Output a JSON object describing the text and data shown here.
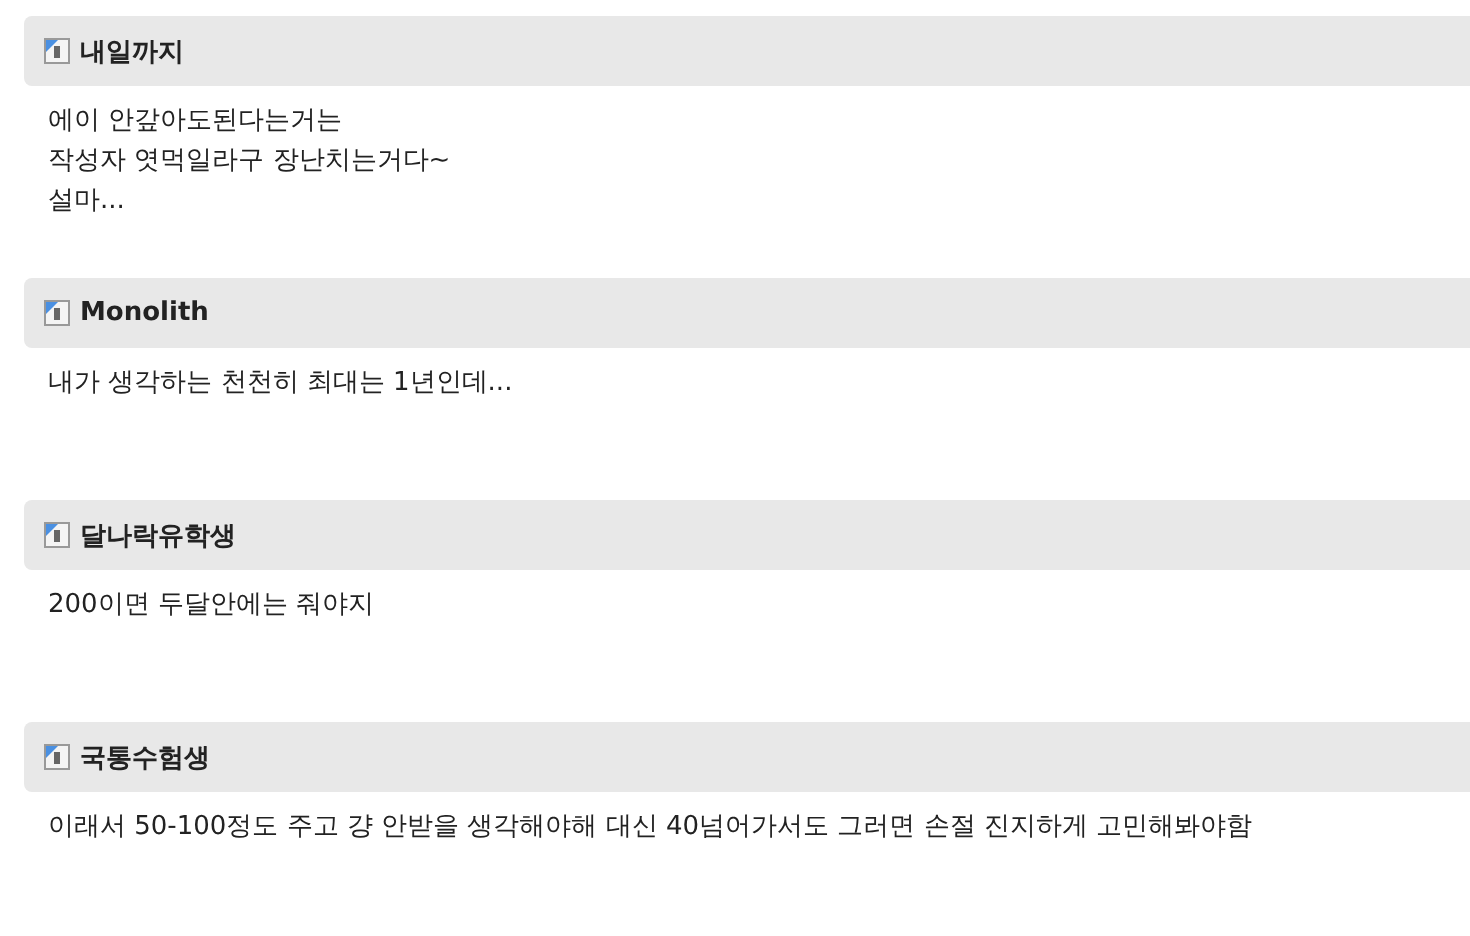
{
  "comments": [
    {
      "author": "내일까지",
      "lines": [
        "에이 안갚아도된다는거는",
        "작성자 엿먹일라구 장난치는거다~",
        "설마..."
      ]
    },
    {
      "author": "Monolith",
      "lines": [
        "내가 생각하는 천천히 최대는 1년인데..."
      ]
    },
    {
      "author": "달나락유학생",
      "lines": [
        "200이면 두달안에는 줘야지"
      ]
    },
    {
      "author": "국통수험생",
      "lines": [
        "이래서 50-100정도 주고 걍 안받을 생각해야해 대신 40넘어가서도 그러면 손절 진지하게 고민해봐야함"
      ]
    }
  ]
}
